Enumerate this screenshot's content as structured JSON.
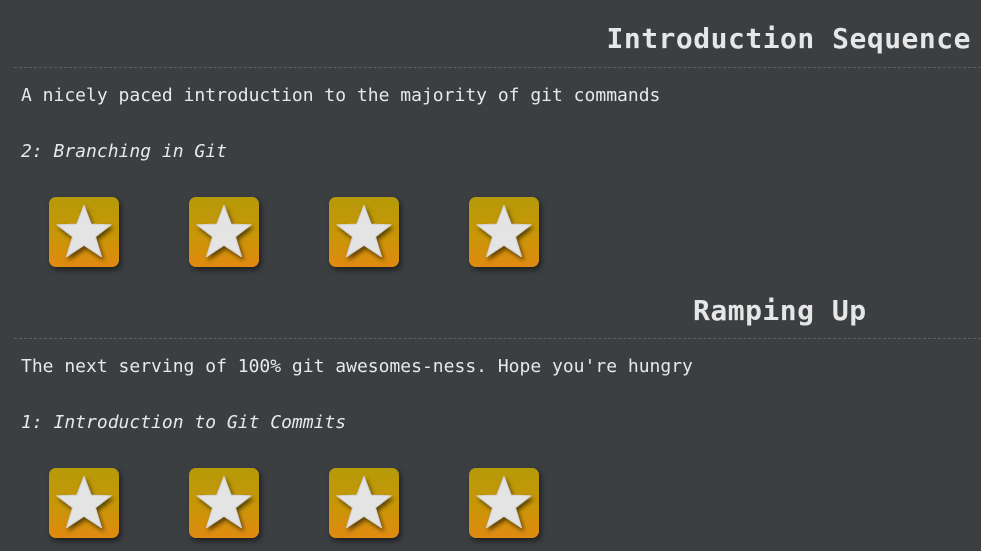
{
  "sections": [
    {
      "title": "Introduction Sequence",
      "description": "A nicely paced introduction to the majority of git commands",
      "level": "2: Branching in Git",
      "stars": [
        {
          "icon": "star-icon"
        },
        {
          "icon": "star-icon"
        },
        {
          "icon": "star-icon"
        },
        {
          "icon": "star-icon"
        }
      ]
    },
    {
      "title": "Ramping Up",
      "description": "The next serving of 100% git awesomes-ness. Hope you're hungry",
      "level": "1: Introduction to Git Commits",
      "stars": [
        {
          "icon": "star-icon"
        },
        {
          "icon": "star-icon"
        },
        {
          "icon": "star-icon"
        },
        {
          "icon": "star-icon"
        }
      ]
    }
  ],
  "colors": {
    "background": "#3c3f42",
    "tile_top": "#b59a08",
    "tile_bottom": "#e08a10",
    "star": "#e4e4e4"
  }
}
